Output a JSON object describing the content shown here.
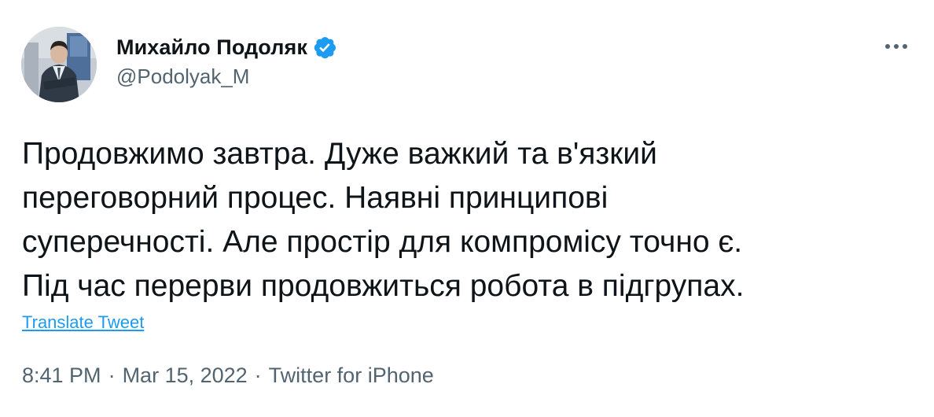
{
  "author": {
    "display_name": "Михайло Подоляк",
    "handle": "@Podolyak_M",
    "verified": true
  },
  "tweet": {
    "lines": [
      "Продовжимо завтра. Дуже важкий та в'язкий",
      "переговорний процес. Наявні принципові",
      "суперечності. Але простір для компромісу точно є.",
      "Під час перерви продовжиться робота в підгрупах."
    ],
    "translate_label": "Translate Tweet"
  },
  "meta": {
    "time": "8:41 PM",
    "separator": "·",
    "date": "Mar 15, 2022",
    "source": "Twitter for iPhone"
  },
  "icons": {
    "verified": "verified-badge-icon",
    "more": "more-horizontal-icon"
  },
  "colors": {
    "text": "#0f1419",
    "secondary": "#536471",
    "link": "#1d9bf0"
  }
}
